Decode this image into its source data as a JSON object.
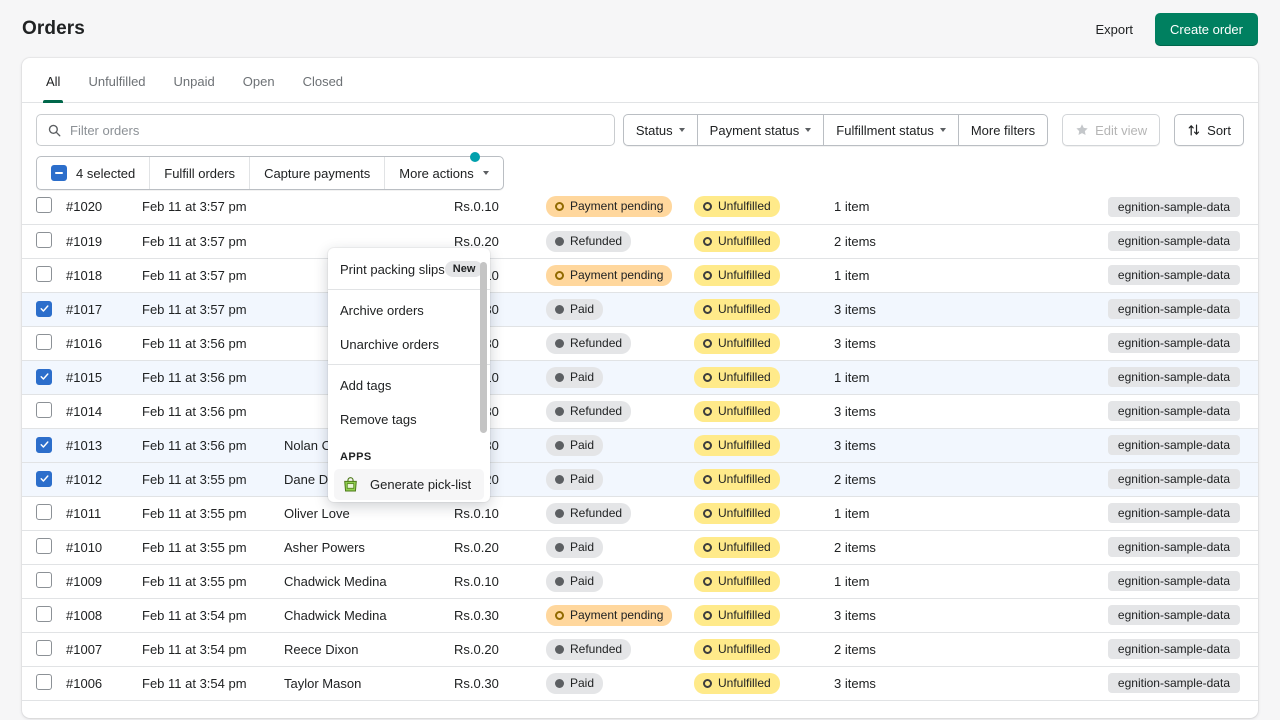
{
  "header": {
    "title": "Orders",
    "export_label": "Export",
    "create_label": "Create order"
  },
  "tabs": [
    {
      "label": "All",
      "active": true
    },
    {
      "label": "Unfulfilled",
      "active": false
    },
    {
      "label": "Unpaid",
      "active": false
    },
    {
      "label": "Open",
      "active": false
    },
    {
      "label": "Closed",
      "active": false
    }
  ],
  "search": {
    "value": "",
    "placeholder": "Filter orders"
  },
  "filters": [
    {
      "label": "Status",
      "caret": true
    },
    {
      "label": "Payment status",
      "caret": true
    },
    {
      "label": "Fulfillment status",
      "caret": true
    },
    {
      "label": "More filters",
      "caret": false
    }
  ],
  "edit_view": {
    "label": "Edit view",
    "disabled": true
  },
  "sort": {
    "label": "Sort"
  },
  "bulk": {
    "selected_label": "4 selected",
    "fulfill_label": "Fulfill orders",
    "capture_label": "Capture payments",
    "more_label": "More actions",
    "has_notification_dot": true
  },
  "dropdown": {
    "items": [
      {
        "label": "Print packing slips",
        "badge": "New"
      },
      {
        "label": "Archive orders",
        "badge": ""
      },
      {
        "label": "Unarchive orders",
        "badge": ""
      },
      {
        "label": "Add tags",
        "badge": ""
      },
      {
        "label": "Remove tags",
        "badge": ""
      }
    ],
    "section_label": "APPS",
    "app_item": "Generate pick-list"
  },
  "colors": {
    "brand_green": "#008060",
    "tab_underline": "#00674a",
    "checkbox_blue": "#2c6ecb",
    "selected_row": "#f2f7fe",
    "notification_teal": "#00a0ac",
    "badge_pending": "#ffd79d",
    "badge_unfulfilled": "#ffea8a",
    "badge_neutral": "#e4e5e7"
  },
  "rows": [
    {
      "id": "#1020",
      "date": "Feb 11 at 3:57 pm",
      "customer": "",
      "total": "Rs.0.10",
      "payment": "Payment pending",
      "payment_kind": "pending",
      "fulfillment": "Unfulfilled",
      "items": "1 item",
      "tag": "egnition-sample-data",
      "selected": false
    },
    {
      "id": "#1019",
      "date": "Feb 11 at 3:57 pm",
      "customer": "",
      "total": "Rs.0.20",
      "payment": "Refunded",
      "payment_kind": "refunded",
      "fulfillment": "Unfulfilled",
      "items": "2 items",
      "tag": "egnition-sample-data",
      "selected": false
    },
    {
      "id": "#1018",
      "date": "Feb 11 at 3:57 pm",
      "customer": "",
      "total": "Rs.0.10",
      "payment": "Payment pending",
      "payment_kind": "pending",
      "fulfillment": "Unfulfilled",
      "items": "1 item",
      "tag": "egnition-sample-data",
      "selected": false
    },
    {
      "id": "#1017",
      "date": "Feb 11 at 3:57 pm",
      "customer": "",
      "total": "Rs.0.30",
      "payment": "Paid",
      "payment_kind": "paid",
      "fulfillment": "Unfulfilled",
      "items": "3 items",
      "tag": "egnition-sample-data",
      "selected": true
    },
    {
      "id": "#1016",
      "date": "Feb 11 at 3:56 pm",
      "customer": "",
      "total": "Rs.0.30",
      "payment": "Refunded",
      "payment_kind": "refunded",
      "fulfillment": "Unfulfilled",
      "items": "3 items",
      "tag": "egnition-sample-data",
      "selected": false
    },
    {
      "id": "#1015",
      "date": "Feb 11 at 3:56 pm",
      "customer": "",
      "total": "Rs.0.10",
      "payment": "Paid",
      "payment_kind": "paid",
      "fulfillment": "Unfulfilled",
      "items": "1 item",
      "tag": "egnition-sample-data",
      "selected": true
    },
    {
      "id": "#1014",
      "date": "Feb 11 at 3:56 pm",
      "customer": "",
      "total": "Rs.0.30",
      "payment": "Refunded",
      "payment_kind": "refunded",
      "fulfillment": "Unfulfilled",
      "items": "3 items",
      "tag": "egnition-sample-data",
      "selected": false
    },
    {
      "id": "#1013",
      "date": "Feb 11 at 3:56 pm",
      "customer": "Nolan Collins",
      "total": "Rs.0.30",
      "payment": "Paid",
      "payment_kind": "paid",
      "fulfillment": "Unfulfilled",
      "items": "3 items",
      "tag": "egnition-sample-data",
      "selected": true
    },
    {
      "id": "#1012",
      "date": "Feb 11 at 3:55 pm",
      "customer": "Dane Daniels",
      "total": "Rs.0.20",
      "payment": "Paid",
      "payment_kind": "paid",
      "fulfillment": "Unfulfilled",
      "items": "2 items",
      "tag": "egnition-sample-data",
      "selected": true
    },
    {
      "id": "#1011",
      "date": "Feb 11 at 3:55 pm",
      "customer": "Oliver Love",
      "total": "Rs.0.10",
      "payment": "Refunded",
      "payment_kind": "refunded",
      "fulfillment": "Unfulfilled",
      "items": "1 item",
      "tag": "egnition-sample-data",
      "selected": false
    },
    {
      "id": "#1010",
      "date": "Feb 11 at 3:55 pm",
      "customer": "Asher Powers",
      "total": "Rs.0.20",
      "payment": "Paid",
      "payment_kind": "paid",
      "fulfillment": "Unfulfilled",
      "items": "2 items",
      "tag": "egnition-sample-data",
      "selected": false
    },
    {
      "id": "#1009",
      "date": "Feb 11 at 3:55 pm",
      "customer": "Chadwick Medina",
      "total": "Rs.0.10",
      "payment": "Paid",
      "payment_kind": "paid",
      "fulfillment": "Unfulfilled",
      "items": "1 item",
      "tag": "egnition-sample-data",
      "selected": false
    },
    {
      "id": "#1008",
      "date": "Feb 11 at 3:54 pm",
      "customer": "Chadwick Medina",
      "total": "Rs.0.30",
      "payment": "Payment pending",
      "payment_kind": "pending",
      "fulfillment": "Unfulfilled",
      "items": "3 items",
      "tag": "egnition-sample-data",
      "selected": false
    },
    {
      "id": "#1007",
      "date": "Feb 11 at 3:54 pm",
      "customer": "Reece Dixon",
      "total": "Rs.0.20",
      "payment": "Refunded",
      "payment_kind": "refunded",
      "fulfillment": "Unfulfilled",
      "items": "2 items",
      "tag": "egnition-sample-data",
      "selected": false
    },
    {
      "id": "#1006",
      "date": "Feb 11 at 3:54 pm",
      "customer": "Taylor Mason",
      "total": "Rs.0.30",
      "payment": "Paid",
      "payment_kind": "paid",
      "fulfillment": "Unfulfilled",
      "items": "3 items",
      "tag": "egnition-sample-data",
      "selected": false
    }
  ]
}
